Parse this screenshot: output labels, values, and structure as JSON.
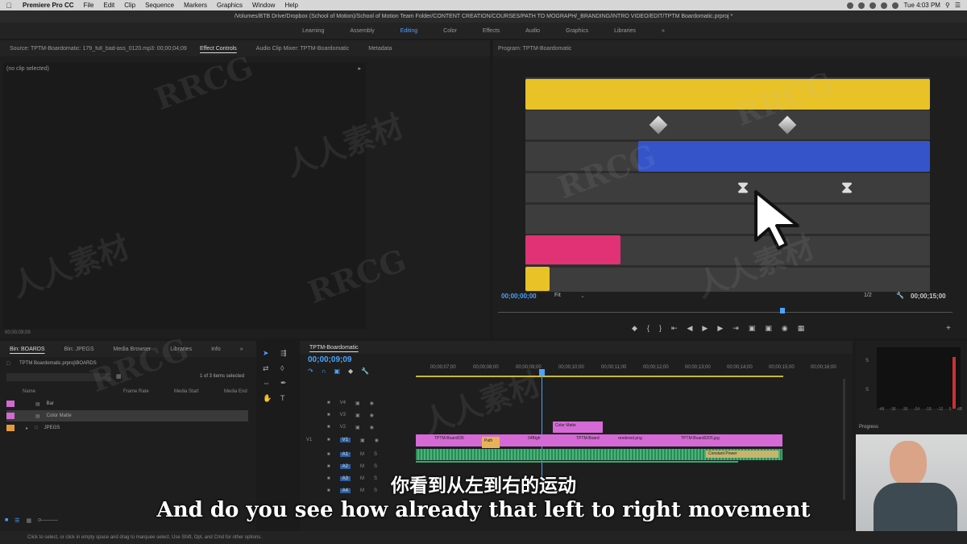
{
  "menubar": {
    "app": "Premiere Pro CC",
    "items": [
      "File",
      "Edit",
      "Clip",
      "Sequence",
      "Markers",
      "Graphics",
      "Window",
      "Help"
    ],
    "clock": "Tue 4:03 PM"
  },
  "titlebar": {
    "path": "/Volumes/BTB Drive/Dropbox (School of Motion)/School of Motion Team Folder/CONTENT CREATION/COURSES/PATH TO MOGRAPH/_BRANDING/INTRO VIDEO/EDIT/TPTM Boardomatic.prproj *"
  },
  "workspaces": {
    "items": [
      "Learning",
      "Assembly",
      "Editing",
      "Color",
      "Effects",
      "Audio",
      "Graphics",
      "Libraries"
    ],
    "active": "Editing",
    "more": "»"
  },
  "source_panel": {
    "tabs": [
      "Source: TPTM-Boardomatic: 179_full_bad-ass_0120.mp3: 00;00;04;09",
      "Effect Controls",
      "Audio Clip Mixer: TPTM-Boardomatic",
      "Metadata"
    ],
    "empty_text": "(no clip selected)",
    "timecode": "00;00;09;09"
  },
  "program_monitor": {
    "title": "Program: TPTM-Boardomatic",
    "timecode_left": "00;00;00;00",
    "fit": "Fit",
    "quality": "1/2",
    "timecode_right": "00;00;15;00",
    "colors": {
      "yellow": "#e8c227",
      "blue": "#3554c9",
      "pink": "#e03274",
      "frame": "#3d3d3d"
    }
  },
  "project_panel": {
    "tabs": [
      "Bin: BOARDS",
      "Bin: JPEGS",
      "Media Browser",
      "Libraries",
      "Info"
    ],
    "path": "TPTM Boardomatic.prproj\\BOARDS",
    "selection": "1 of 3 items selected",
    "columns": [
      "Name",
      "Frame Rate",
      "Media Start",
      "Media End"
    ],
    "items": [
      {
        "name": "Bar",
        "color": "#d26ad2"
      },
      {
        "name": "Color Matte",
        "color": "#d26ad2"
      },
      {
        "name": "JPEGS",
        "color": "#e59a3a"
      }
    ]
  },
  "timeline": {
    "tab": "TPTM-Boardomatic",
    "timecode": "00;00;09;09",
    "ruler": [
      "00;00;07;00",
      "00;00;08;00",
      "00;00;09;00",
      "00;00;10;00",
      "00;00;11;00",
      "00;00;12;00",
      "00;00;13;00",
      "00;00;14;00",
      "00;00;15;00",
      "00;00;16;00"
    ],
    "video_tracks": [
      "V4",
      "V3",
      "V2",
      "V1"
    ],
    "audio_tracks": [
      "A1",
      "A2",
      "A3",
      "A4"
    ],
    "clips": {
      "color_matte": "Color Matte",
      "v1_a": "TPTM-Board035",
      "v1_b": "Path",
      "v1_c": "04Bigh",
      "v1_d": "TPTM-Board",
      "v1_e": "rendered.png",
      "v1_f": "TPTM-Board0205.jpg",
      "audio_label": "Constant Power"
    }
  },
  "audio_meter": {
    "scale": [
      "0",
      "-6",
      "-12",
      "-18",
      "-24",
      "-30",
      "-36",
      "-42",
      "-48",
      "dB"
    ],
    "s_labels": [
      "S",
      "S"
    ]
  },
  "progress_panel": {
    "title": "Progress"
  },
  "statusbar": {
    "text": "Click to select, or click in empty space and drag to marquee select. Use Shift, Opt, and Cmd for other options."
  },
  "subtitles": {
    "zh": "你看到从左到右的运动",
    "en": "And do you see how already that left to right movement"
  },
  "watermarks": [
    "RRCG",
    "人人素材"
  ]
}
